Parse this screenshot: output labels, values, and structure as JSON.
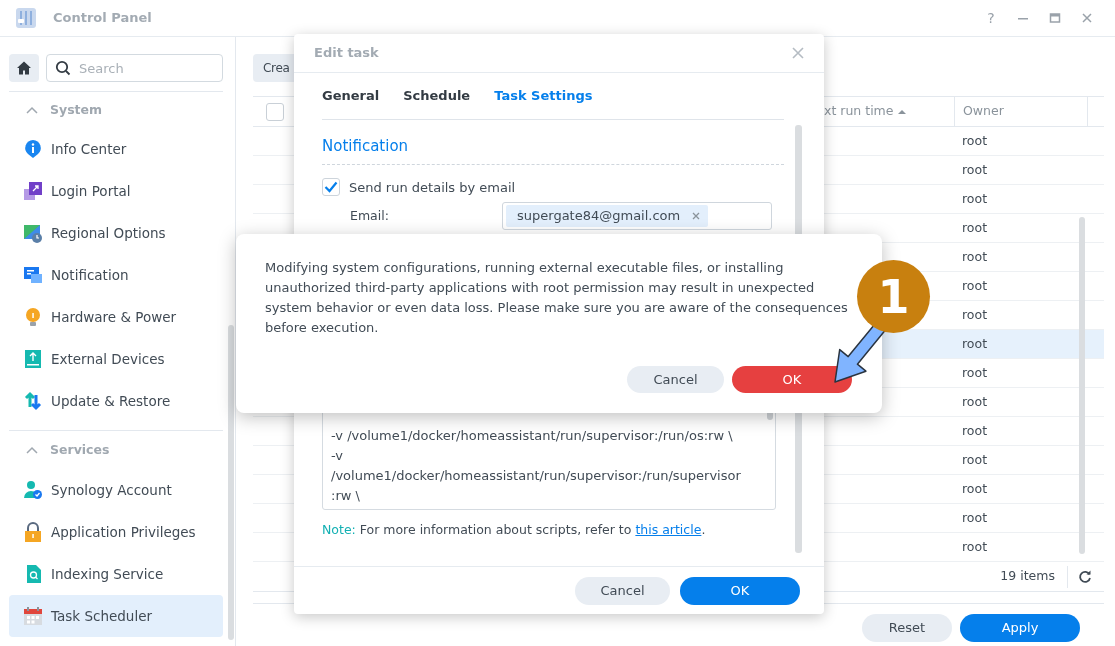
{
  "window": {
    "title": "Control Panel",
    "help": "?"
  },
  "sidebar": {
    "search": {
      "placeholder": "Search"
    },
    "sections": [
      {
        "title": "System",
        "expanded": true,
        "items": [
          {
            "label": "Info Center",
            "selected": false
          },
          {
            "label": "Login Portal",
            "selected": false
          },
          {
            "label": "Regional Options",
            "selected": false
          },
          {
            "label": "Notification",
            "selected": false
          },
          {
            "label": "Hardware & Power",
            "selected": false
          },
          {
            "label": "External Devices",
            "selected": false
          },
          {
            "label": "Update & Restore",
            "selected": false
          }
        ]
      },
      {
        "title": "Services",
        "expanded": true,
        "items": [
          {
            "label": "Synology Account",
            "selected": false
          },
          {
            "label": "Application Privileges",
            "selected": false
          },
          {
            "label": "Indexing Service",
            "selected": false
          },
          {
            "label": "Task Scheduler",
            "selected": true
          }
        ]
      }
    ]
  },
  "toolbar": {
    "create_button": "Crea"
  },
  "table": {
    "columns": [
      {
        "kind": "check",
        "checked": false
      },
      {
        "label": "xt run time",
        "kind": "sort",
        "sort_ascending": true
      },
      {
        "label": "Owner",
        "kind": "plain"
      }
    ],
    "rows": [
      {
        "owner": "root",
        "selected": false
      },
      {
        "owner": "root",
        "selected": false
      },
      {
        "owner": "root",
        "selected": false
      },
      {
        "owner": "root",
        "selected": false
      },
      {
        "owner": "root",
        "selected": false
      },
      {
        "owner": "root",
        "selected": false
      },
      {
        "owner": "root",
        "selected": false
      },
      {
        "owner": "root",
        "selected": true
      },
      {
        "owner": "root",
        "selected": false
      },
      {
        "owner": "root",
        "selected": false
      },
      {
        "owner": "root",
        "selected": false
      },
      {
        "owner": "root",
        "selected": false
      },
      {
        "owner": "root",
        "selected": false
      },
      {
        "owner": "root",
        "selected": false
      },
      {
        "owner": "root",
        "selected": false
      }
    ],
    "count": "19 items"
  },
  "footer_buttons": [
    {
      "label": "Reset",
      "kind": "secondary"
    },
    {
      "label": "Apply",
      "kind": "primary"
    }
  ],
  "edit_dialog": {
    "title": "Edit task",
    "tabs": [
      {
        "label": "General",
        "selected": false
      },
      {
        "label": "Schedule",
        "selected": false
      },
      {
        "label": "Task Settings",
        "selected": true
      }
    ],
    "section": "Notification",
    "send_email": {
      "label": "Send run details by email",
      "checked": true
    },
    "email": {
      "label": "Email:",
      "tags": [
        "supergate84@gmail.com"
      ]
    },
    "script_lines": [
      "-v /volume1/docker/homeassistant/run/supervisor:/run/os:rw \\",
      "-v",
      "/volume1/docker/homeassistant/run/supervisor:/run/supervisor",
      ":rw \\"
    ],
    "note": {
      "label": "Note:",
      "text": "For more information about scripts, refer to ",
      "link": "this article",
      "end": "."
    },
    "buttons": [
      {
        "label": "Cancel",
        "kind": "secondary"
      },
      {
        "label": "OK",
        "kind": "primary"
      }
    ]
  },
  "confirm_dialog": {
    "message": "Modifying system configurations, running external executable files, or installing unauthorized third-party applications with root permission may result in unexpected system behavior or even data loss. Please make sure you are aware of the consequences before execution.",
    "buttons": [
      {
        "label": "Cancel",
        "kind": "secondary"
      },
      {
        "label": "OK",
        "kind": "danger"
      }
    ]
  },
  "annotation": {
    "step": "1"
  }
}
